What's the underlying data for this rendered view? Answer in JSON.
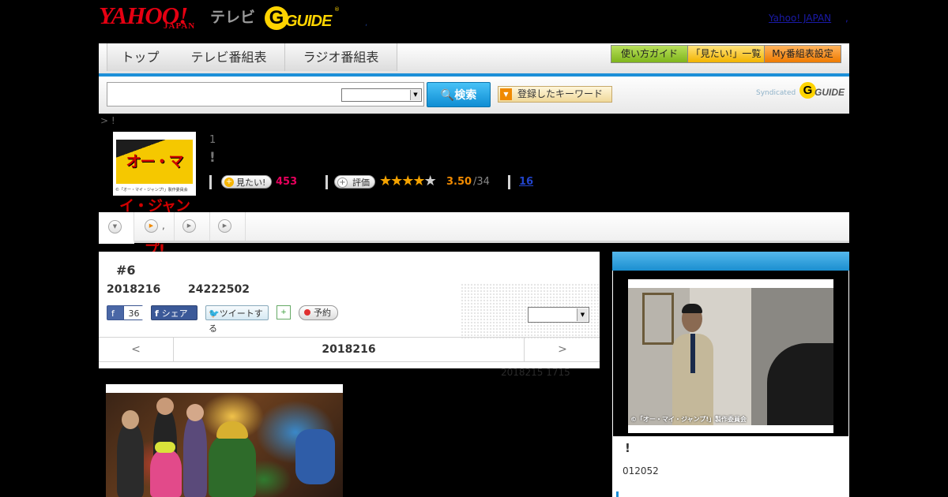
{
  "header": {
    "yahoo_logo_text": "YAHOO!",
    "yahoo_logo_sub": "JAPAN",
    "tv_label": "テレビ",
    "gguide_text": "GUIDE",
    "gguide_g": "G",
    "reg_mark": "®",
    "dot_separator": ",",
    "yahoo_japan_link": "Yahoo! JAPAN",
    "comma": ","
  },
  "nav": {
    "tabs": [
      "トップ",
      "テレビ番組表",
      "ラジオ番組表"
    ],
    "buttons": [
      "使い方ガイド",
      "「見たい!」一覧",
      "My番組表設定"
    ]
  },
  "search": {
    "input_value": "",
    "select_value": "",
    "search_label": "検索",
    "search_icon": "magnifier-icon",
    "keyword_label": "登録したキーワード",
    "syndicated_label": "Syndicated",
    "syndicated_logo_text": "GUIDE",
    "syndicated_logo_g": "G"
  },
  "breadcrumb": "> !",
  "program": {
    "thumb_title": "オー・マイ・ジャンプ!",
    "thumb_caption": "©「オー・マイ・ジャンプ!」製作委員会",
    "episode_number": "1",
    "title": "!",
    "want_label": "見たい!",
    "want_count": "453",
    "rate_label": "評価",
    "rating": "3.50",
    "rating_count": "/34",
    "stars_filled": 3.5,
    "stars_total": 5,
    "review_count": "16"
  },
  "tabs": {
    "items": [
      {
        "icon": "chevron-down-icon",
        "label": ""
      },
      {
        "icon": "play-icon",
        "label": ","
      },
      {
        "icon": "play-icon",
        "label": ""
      },
      {
        "icon": "play-icon",
        "label": ""
      }
    ]
  },
  "episode": {
    "heading": "#6",
    "date": "2018216",
    "time": "24222502",
    "like_label": "36",
    "share_label": "シェア",
    "tweet_label": "ツイートする",
    "reserve_label": "予約",
    "select_value": "",
    "nav_prev": "<",
    "nav_current": "2018216",
    "nav_next": ">"
  },
  "updated": "2018215  1715",
  "sidebar": {
    "photo_caption": "©「オー・マイ・ジャンプ!」製作委員会",
    "title": "!",
    "number": "012052"
  },
  "colors": {
    "accent_blue": "#1c8fd8",
    "want_count": "#e6005c",
    "rating": "#f08a00"
  }
}
